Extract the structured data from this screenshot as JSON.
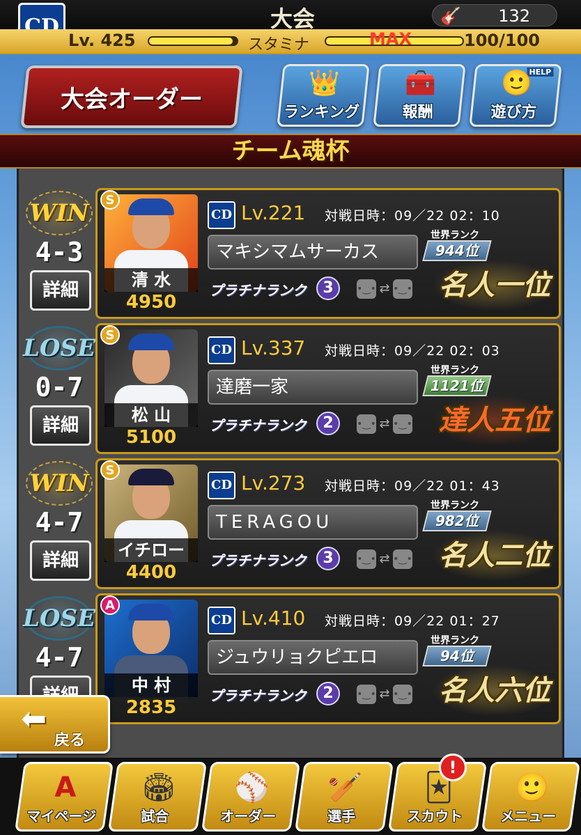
{
  "header": {
    "team_logo_text": "CD",
    "title": "大会",
    "coins": "132",
    "level_label": "Lv. 425",
    "level_progress": 0.95,
    "stamina_label": "スタミナ",
    "stamina_max": "MAX",
    "stamina_value": "100/100",
    "stamina_progress": 1.0
  },
  "buttons": {
    "order": "大会オーダー",
    "ranking": "ランキング",
    "reward": "報酬",
    "help": "遊び方",
    "help_tag": "HELP"
  },
  "section_title": "チーム魂杯",
  "matches": [
    {
      "result": "WIN",
      "score": "4-3",
      "detail_label": "詳細",
      "rank_letter": "S",
      "player_name": "清 水",
      "player_power": "4950",
      "opponent_level": "Lv.221",
      "match_time": "対戦日時：09／22 02：10",
      "opponent_name": "マキシマムサーカス",
      "platinum_label": "プラチナランク",
      "platinum_num": "3",
      "world_rank_label": "世界ランク",
      "world_rank": "944位",
      "dan": "名人一位"
    },
    {
      "result": "LOSE",
      "score": "0-7",
      "detail_label": "詳細",
      "rank_letter": "S",
      "player_name": "松 山",
      "player_power": "5100",
      "opponent_level": "Lv.337",
      "match_time": "対戦日時：09／22 02：03",
      "opponent_name": "達磨一家",
      "platinum_label": "プラチナランク",
      "platinum_num": "2",
      "world_rank_label": "世界ランク",
      "world_rank": "1121位",
      "dan": "達人五位"
    },
    {
      "result": "WIN",
      "score": "4-7",
      "detail_label": "詳細",
      "rank_letter": "S",
      "player_name": "イチロー",
      "player_power": "4400",
      "opponent_level": "Lv.273",
      "match_time": "対戦日時：09／22 01：43",
      "opponent_name": "TERAGOU",
      "platinum_label": "プラチナランク",
      "platinum_num": "3",
      "world_rank_label": "世界ランク",
      "world_rank": "982位",
      "dan": "名人二位"
    },
    {
      "result": "LOSE",
      "score": "4-7",
      "detail_label": "詳細",
      "rank_letter": "A",
      "player_name": "中 村",
      "player_power": "2835",
      "opponent_level": "Lv.410",
      "match_time": "対戦日時：09／22 01：27",
      "opponent_name": "ジュウリョクピエロ",
      "platinum_label": "プラチナランク",
      "platinum_num": "2",
      "world_rank_label": "世界ランク",
      "world_rank": "94位",
      "dan": "名人六位"
    }
  ],
  "back_label": "戻る",
  "nav": [
    "マイページ",
    "試合",
    "オーダー",
    "選手",
    "スカウト",
    "メニュー"
  ],
  "alert_mark": "!",
  "colors": {
    "accent_gold": "#c99a1a",
    "title_yellow": "#ffd64a",
    "power_yellow": "#ffcb3a",
    "team_blue": "#0b3d91"
  }
}
